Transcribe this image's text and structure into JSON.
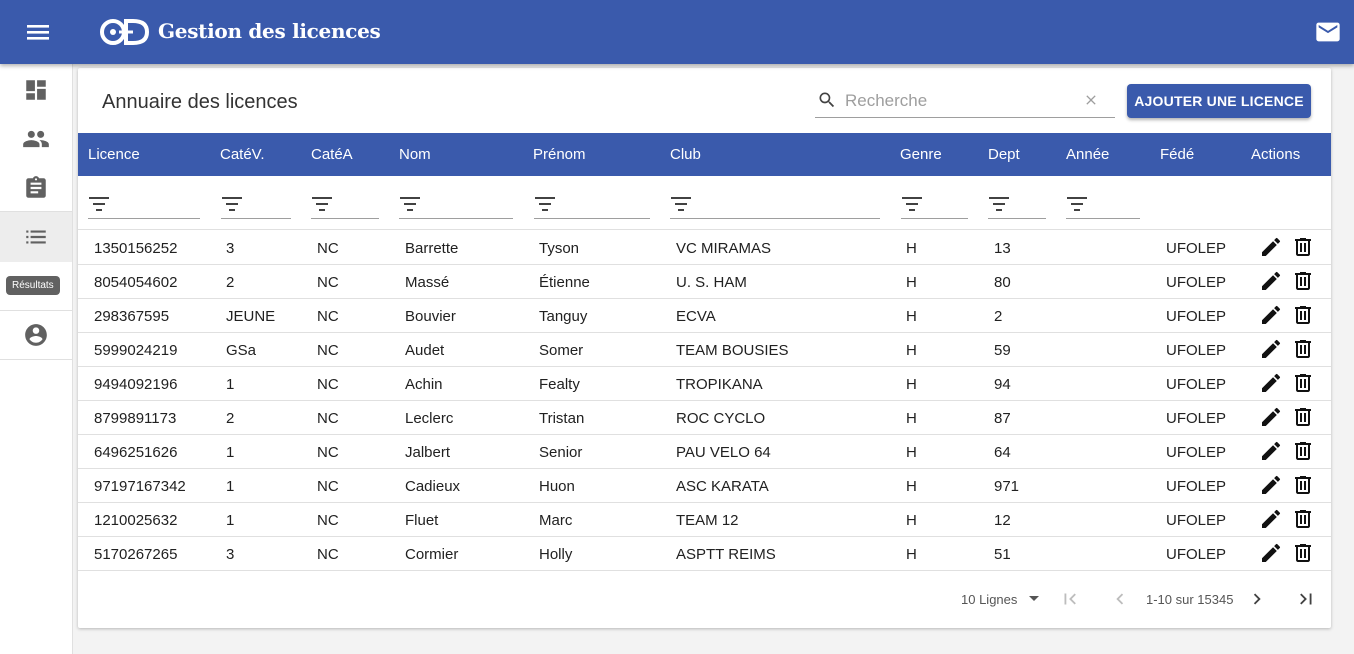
{
  "app": {
    "title": "Gestion des licences",
    "logo_text": "OD"
  },
  "sidebar": {
    "items": [
      {
        "name": "dashboard-icon"
      },
      {
        "name": "people-icon"
      },
      {
        "name": "clipboard-icon"
      },
      {
        "name": "list-icon",
        "active": true
      },
      {
        "name": "account-circle-icon"
      }
    ],
    "tooltip": "Résultats"
  },
  "card": {
    "title": "Annuaire des licences",
    "search": {
      "placeholder": "Recherche",
      "value": ""
    },
    "add_button": "AJOUTER UNE LICENCE"
  },
  "table": {
    "columns": [
      "Licence",
      "CatéV.",
      "CatéA",
      "Nom",
      "Prénom",
      "Club",
      "Genre",
      "Dept",
      "Année",
      "Fédé",
      "Actions"
    ],
    "rows": [
      [
        "1350156252",
        "3",
        "NC",
        "Barrette",
        "Tyson",
        "VC MIRAMAS",
        "H",
        "13",
        "",
        "UFOLEP"
      ],
      [
        "8054054602",
        "2",
        "NC",
        "Massé",
        "Étienne",
        "U. S. HAM",
        "H",
        "80",
        "",
        "UFOLEP"
      ],
      [
        "298367595",
        "JEUNE",
        "NC",
        "Bouvier",
        "Tanguy",
        "ECVA",
        "H",
        "2",
        "",
        "UFOLEP"
      ],
      [
        "5999024219",
        "GSa",
        "NC",
        "Audet",
        "Somer",
        "TEAM BOUSIES",
        "H",
        "59",
        "",
        "UFOLEP"
      ],
      [
        "9494092196",
        "1",
        "NC",
        "Achin",
        "Fealty",
        "TROPIKANA",
        "H",
        "94",
        "",
        "UFOLEP"
      ],
      [
        "8799891173",
        "2",
        "NC",
        "Leclerc",
        "Tristan",
        "ROC CYCLO",
        "H",
        "87",
        "",
        "UFOLEP"
      ],
      [
        "6496251626",
        "1",
        "NC",
        "Jalbert",
        "Senior",
        "PAU VELO 64",
        "H",
        "64",
        "",
        "UFOLEP"
      ],
      [
        "97197167342",
        "1",
        "NC",
        "Cadieux",
        "Huon",
        "ASC KARATA",
        "H",
        "971",
        "",
        "UFOLEP"
      ],
      [
        "1210025632",
        "1",
        "NC",
        "Fluet",
        "Marc",
        "TEAM 12",
        "H",
        "12",
        "",
        "UFOLEP"
      ],
      [
        "5170267265",
        "3",
        "NC",
        "Cormier",
        "Holly",
        "ASPTT REIMS",
        "H",
        "51",
        "",
        "UFOLEP"
      ]
    ]
  },
  "pagination": {
    "rows_per_page": "10 Lignes",
    "range": "1-10 sur 15345"
  },
  "colors": {
    "primary": "#3a5aac",
    "white": "#ffffff"
  }
}
